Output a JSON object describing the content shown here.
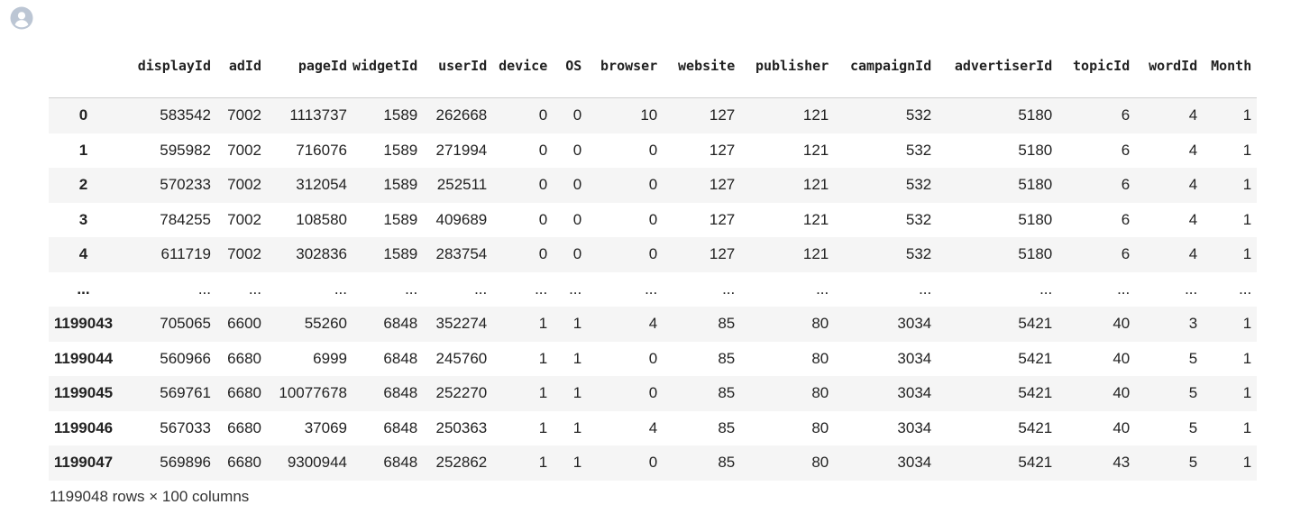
{
  "dataframe": {
    "columns": [
      "displayId",
      "adId",
      "pageId",
      "widgetId",
      "userId",
      "device",
      "OS",
      "browser",
      "website",
      "publisher",
      "campaignId",
      "advertiserId",
      "topicId",
      "wordId",
      "Month"
    ],
    "rows": [
      {
        "index": "0",
        "cells": [
          "583542",
          "7002",
          "1113737",
          "1589",
          "262668",
          "0",
          "0",
          "10",
          "127",
          "121",
          "532",
          "5180",
          "6",
          "4",
          "1"
        ]
      },
      {
        "index": "1",
        "cells": [
          "595982",
          "7002",
          "716076",
          "1589",
          "271994",
          "0",
          "0",
          "0",
          "127",
          "121",
          "532",
          "5180",
          "6",
          "4",
          "1"
        ]
      },
      {
        "index": "2",
        "cells": [
          "570233",
          "7002",
          "312054",
          "1589",
          "252511",
          "0",
          "0",
          "0",
          "127",
          "121",
          "532",
          "5180",
          "6",
          "4",
          "1"
        ]
      },
      {
        "index": "3",
        "cells": [
          "784255",
          "7002",
          "108580",
          "1589",
          "409689",
          "0",
          "0",
          "0",
          "127",
          "121",
          "532",
          "5180",
          "6",
          "4",
          "1"
        ]
      },
      {
        "index": "4",
        "cells": [
          "611719",
          "7002",
          "302836",
          "1589",
          "283754",
          "0",
          "0",
          "0",
          "127",
          "121",
          "532",
          "5180",
          "6",
          "4",
          "1"
        ]
      },
      {
        "index": "...",
        "cells": [
          "...",
          "...",
          "...",
          "...",
          "...",
          "...",
          "...",
          "...",
          "...",
          "...",
          "...",
          "...",
          "...",
          "...",
          "..."
        ]
      },
      {
        "index": "1199043",
        "cells": [
          "705065",
          "6600",
          "55260",
          "6848",
          "352274",
          "1",
          "1",
          "4",
          "85",
          "80",
          "3034",
          "5421",
          "40",
          "3",
          "1"
        ]
      },
      {
        "index": "1199044",
        "cells": [
          "560966",
          "6680",
          "6999",
          "6848",
          "245760",
          "1",
          "1",
          "0",
          "85",
          "80",
          "3034",
          "5421",
          "40",
          "5",
          "1"
        ]
      },
      {
        "index": "1199045",
        "cells": [
          "569761",
          "6680",
          "10077678",
          "6848",
          "252270",
          "1",
          "1",
          "0",
          "85",
          "80",
          "3034",
          "5421",
          "40",
          "5",
          "1"
        ]
      },
      {
        "index": "1199046",
        "cells": [
          "567033",
          "6680",
          "37069",
          "6848",
          "250363",
          "1",
          "1",
          "4",
          "85",
          "80",
          "3034",
          "5421",
          "40",
          "5",
          "1"
        ]
      },
      {
        "index": "1199047",
        "cells": [
          "569896",
          "6680",
          "9300944",
          "6848",
          "252862",
          "1",
          "1",
          "0",
          "85",
          "80",
          "3034",
          "5421",
          "43",
          "5",
          "1"
        ]
      }
    ],
    "shape_text": "1199048 rows × 100 columns"
  },
  "icons": {
    "avatar": "user-avatar-icon"
  },
  "colors": {
    "avatar_bg": "#bcc6d4",
    "row_stripe": "#f5f5f5",
    "header_border": "#cfcfcf"
  }
}
